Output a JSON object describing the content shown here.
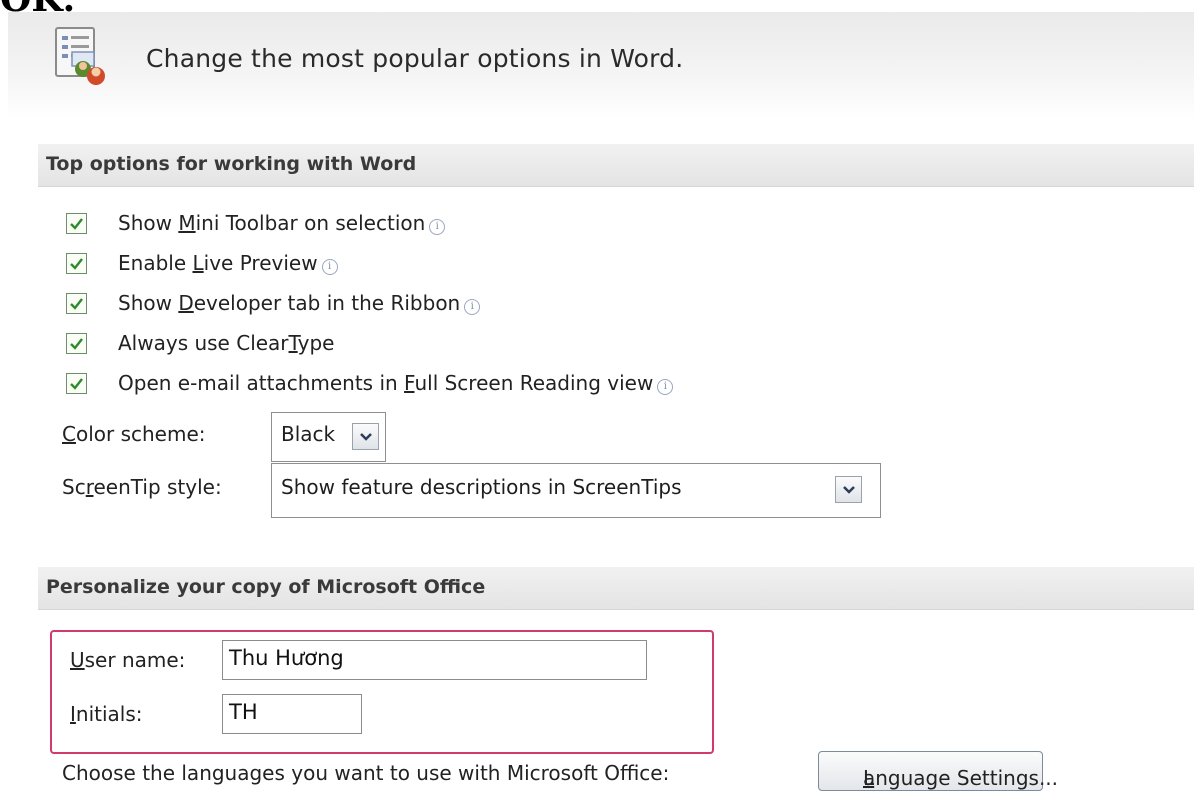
{
  "top_crop_text": "OK.",
  "header": {
    "text": "Change the most popular options in Word."
  },
  "sections": {
    "top_options": "Top options for working with Word",
    "personalize": "Personalize your copy of Microsoft Office"
  },
  "options": [
    {
      "pre": "Show ",
      "key": "M",
      "post": "ini Toolbar on selection",
      "checked": true,
      "info": true
    },
    {
      "pre": "Enable ",
      "key": "L",
      "post": "ive Preview",
      "checked": true,
      "info": true
    },
    {
      "pre": "Show ",
      "key": "D",
      "post": "eveloper tab in the Ribbon",
      "checked": true,
      "info": true
    },
    {
      "pre": "Always use Clear",
      "key": "T",
      "post": "ype",
      "checked": true,
      "info": false
    },
    {
      "pre": "Open e-mail attachments in ",
      "key": "F",
      "post": "ull Screen Reading view",
      "checked": true,
      "info": true
    }
  ],
  "color_scheme": {
    "key": "C",
    "label_rest": "olor scheme:",
    "value": "Black"
  },
  "screentip": {
    "pre": "Sc",
    "key": "r",
    "post": "eenTip style:",
    "value": "Show feature descriptions in ScreenTips"
  },
  "user": {
    "username_key": "U",
    "username_rest": "ser name:",
    "username_value": "Thu Hương",
    "initials_key": "I",
    "initials_rest": "nitials:",
    "initials_value": "TH"
  },
  "language": {
    "prompt": "Choose the languages you want to use with Microsoft Office:",
    "button_key": "L",
    "button_rest": "anguage Settings..."
  }
}
